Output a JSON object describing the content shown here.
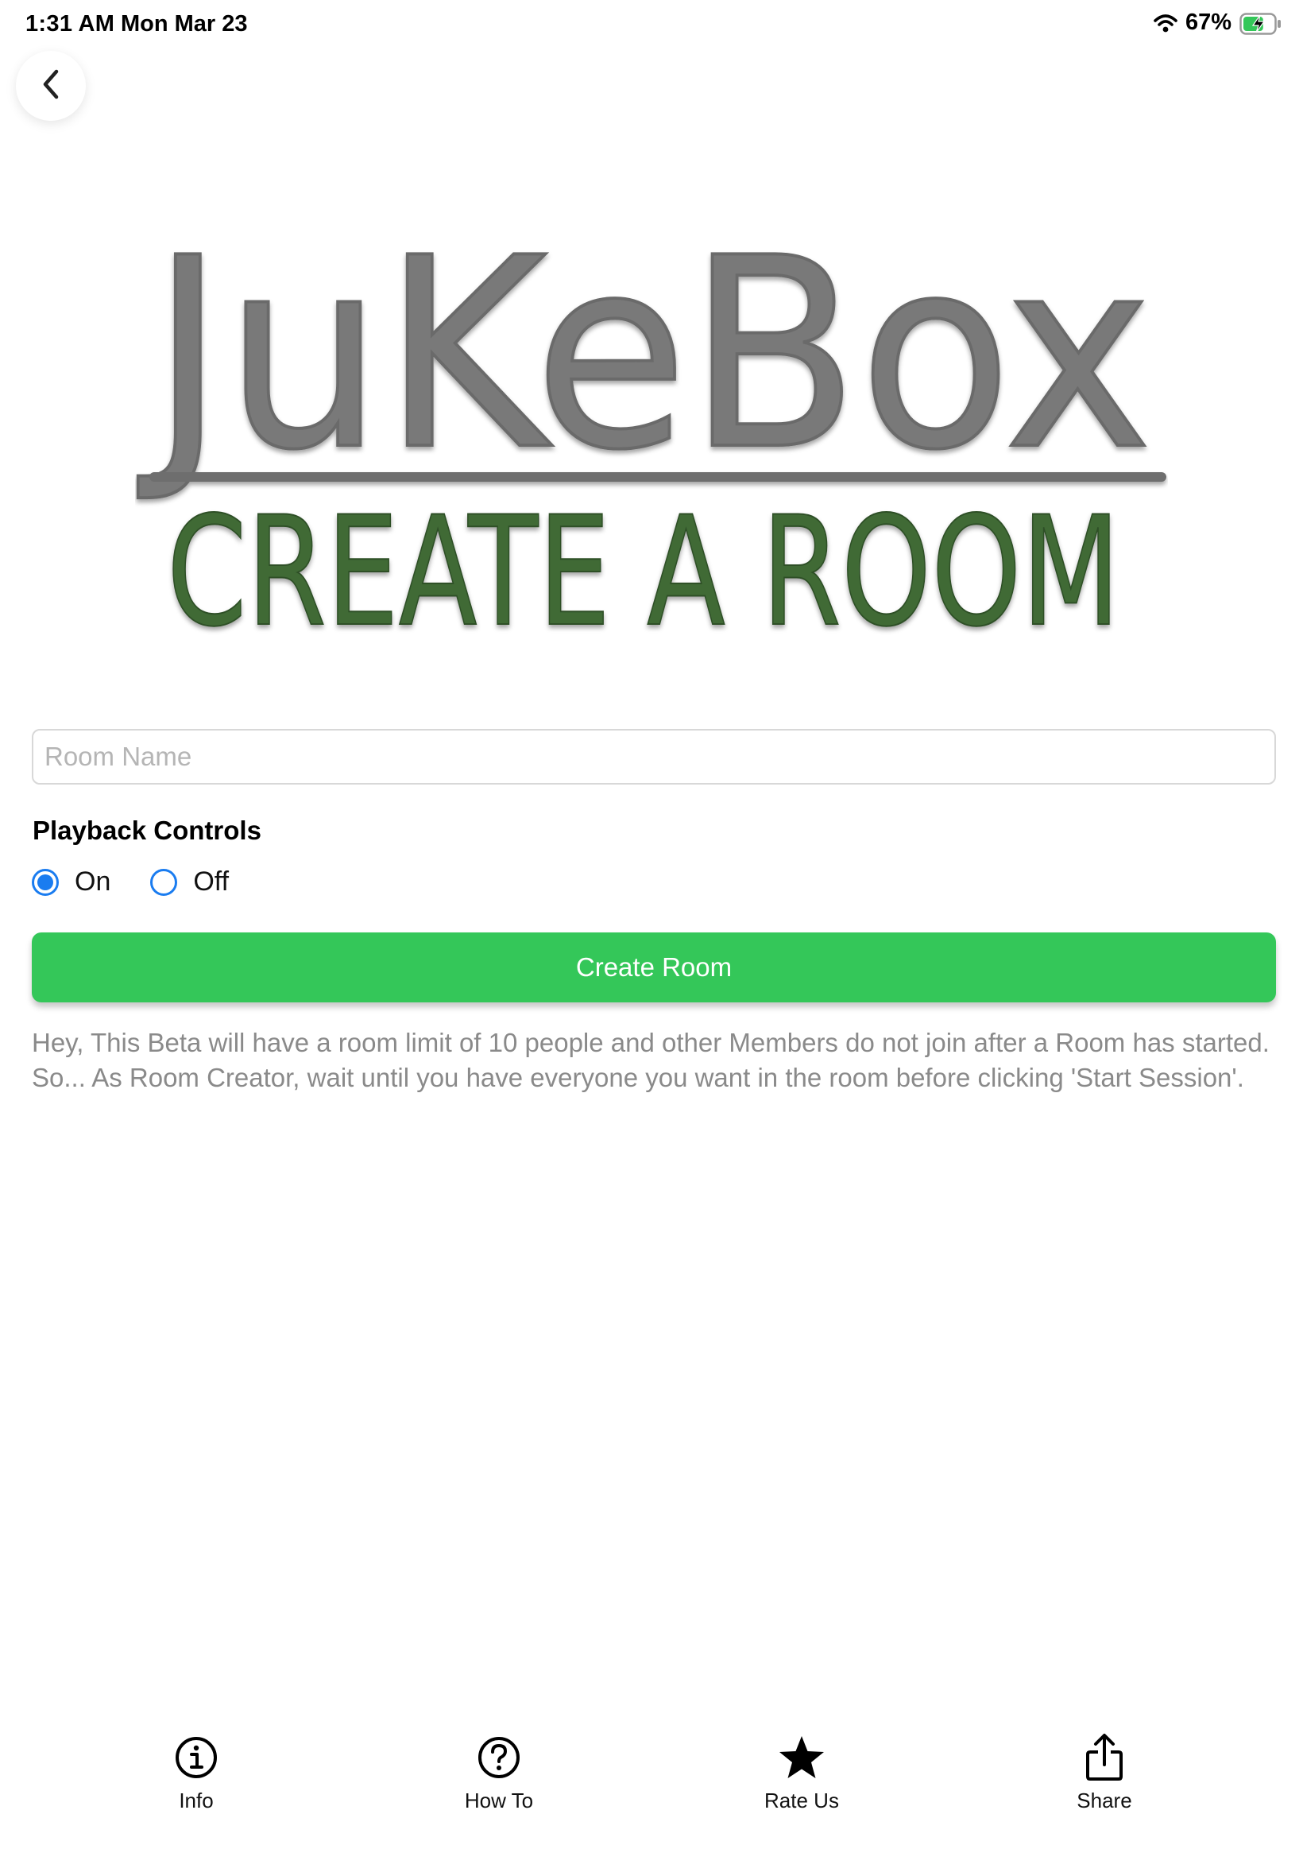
{
  "status_bar": {
    "time": "1:31 AM",
    "date": "Mon Mar 23",
    "battery_percent": "67%",
    "battery_level": 0.67,
    "icons": [
      "wifi-icon",
      "battery-charging-icon"
    ]
  },
  "nav": {
    "back_icon": "chevron-left-icon"
  },
  "logo": {
    "title": "JuKeBox",
    "subtitle": "CREATE A ROOM",
    "title_color": "#777777",
    "subtitle_color": "#3d6b35"
  },
  "form": {
    "room_name_placeholder": "Room Name",
    "room_name_value": "",
    "playback_label": "Playback Controls",
    "options": [
      {
        "label": "On",
        "selected": true
      },
      {
        "label": "Off",
        "selected": false
      }
    ],
    "create_button_label": "Create Room",
    "info_text": "Hey, This Beta will have a room limit of 10 people and other Members do not join after a Room has started. So... As Room Creator, wait until you have everyone you want in the room before clicking 'Start Session'."
  },
  "colors": {
    "accent_green": "#34c759",
    "radio_blue": "#1a7cf0",
    "info_text": "#8a8a8a"
  },
  "tabs": [
    {
      "label": "Info",
      "icon": "info-circle-icon"
    },
    {
      "label": "How To",
      "icon": "question-circle-icon"
    },
    {
      "label": "Rate Us",
      "icon": "star-icon"
    },
    {
      "label": "Share",
      "icon": "share-icon"
    }
  ]
}
